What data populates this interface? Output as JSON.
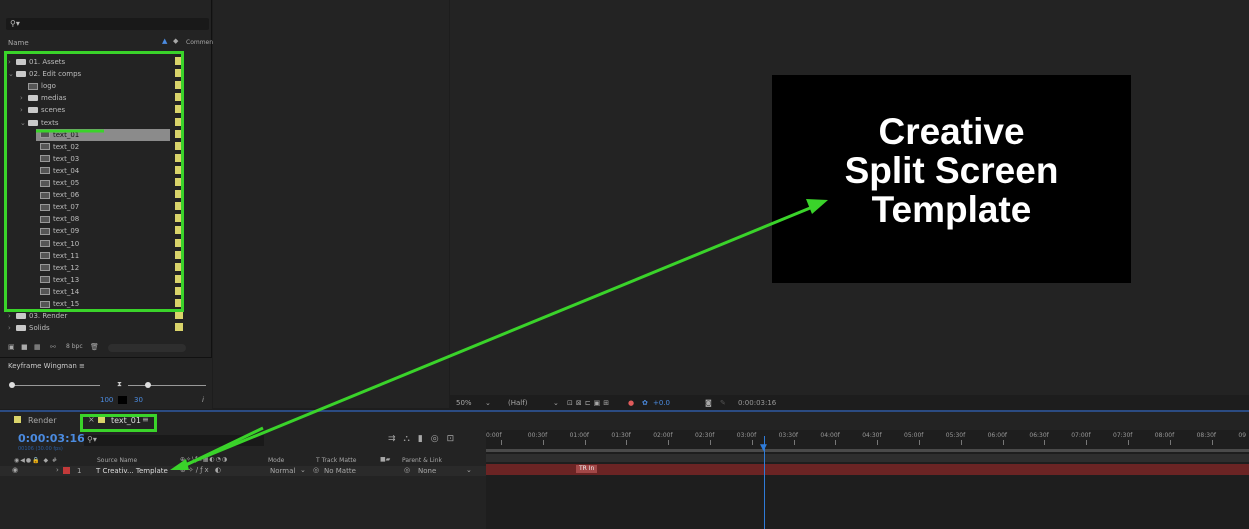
{
  "project": {
    "search_placeholder": "⚲▾",
    "col_name": "Name",
    "col_comment": "Comment",
    "rows": [
      {
        "label": "01. Assets",
        "type": "folder",
        "indent": 0,
        "chev": "›"
      },
      {
        "label": "02. Edit comps",
        "type": "folder",
        "indent": 0,
        "chev": "⌄"
      },
      {
        "label": "logo",
        "type": "comp",
        "indent": 1,
        "chev": ""
      },
      {
        "label": "medias",
        "type": "folder",
        "indent": 1,
        "chev": "›"
      },
      {
        "label": "scenes",
        "type": "folder",
        "indent": 1,
        "chev": "›"
      },
      {
        "label": "texts",
        "type": "folder",
        "indent": 1,
        "chev": "⌄"
      },
      {
        "label": "text_01",
        "type": "comp",
        "indent": 2,
        "chev": "",
        "selected": true
      },
      {
        "label": "text_02",
        "type": "comp",
        "indent": 2,
        "chev": ""
      },
      {
        "label": "text_03",
        "type": "comp",
        "indent": 2,
        "chev": ""
      },
      {
        "label": "text_04",
        "type": "comp",
        "indent": 2,
        "chev": ""
      },
      {
        "label": "text_05",
        "type": "comp",
        "indent": 2,
        "chev": ""
      },
      {
        "label": "text_06",
        "type": "comp",
        "indent": 2,
        "chev": ""
      },
      {
        "label": "text_07",
        "type": "comp",
        "indent": 2,
        "chev": ""
      },
      {
        "label": "text_08",
        "type": "comp",
        "indent": 2,
        "chev": ""
      },
      {
        "label": "text_09",
        "type": "comp",
        "indent": 2,
        "chev": ""
      },
      {
        "label": "text_10",
        "type": "comp",
        "indent": 2,
        "chev": ""
      },
      {
        "label": "text_11",
        "type": "comp",
        "indent": 2,
        "chev": ""
      },
      {
        "label": "text_12",
        "type": "comp",
        "indent": 2,
        "chev": ""
      },
      {
        "label": "text_13",
        "type": "comp",
        "indent": 2,
        "chev": ""
      },
      {
        "label": "text_14",
        "type": "comp",
        "indent": 2,
        "chev": ""
      },
      {
        "label": "text_15",
        "type": "comp",
        "indent": 2,
        "chev": ""
      },
      {
        "label": "03. Render",
        "type": "folder",
        "indent": 0,
        "chev": "›"
      },
      {
        "label": "Solids",
        "type": "folder",
        "indent": 0,
        "chev": "›"
      }
    ],
    "bpc": "8 bpc"
  },
  "wingman": {
    "title": "Keyframe Wingman  ≡",
    "val1": "100",
    "val2": "30",
    "italic": "i"
  },
  "poster": {
    "line1": "Creative",
    "line2": "Split Screen",
    "line3": "Template"
  },
  "viewbar": {
    "zoom": "50%",
    "res": "(Half)",
    "exposure": "+0.0",
    "timecode": "0:00:03:16"
  },
  "timeline": {
    "tab_render": "Render",
    "tab_comp": "text_01",
    "current_time": "0:00:03:16",
    "frames": "00106 (30.00 fps)",
    "search_placeholder": "⚲▾",
    "col_source": "Source Name",
    "col_mode": "Mode",
    "col_t": "T  Track Matte",
    "col_parent": "Parent & Link",
    "layer_num": "1",
    "layer_name": "T  Creativ... Template",
    "layer_mode": "Normal",
    "layer_matte": "No Matte",
    "layer_parent": "None",
    "marker": "TR In",
    "ruler": [
      "0:00f",
      "00:30f",
      "01:00f",
      "01:30f",
      "02:00f",
      "02:30f",
      "03:00f",
      "03:30f",
      "04:00f",
      "04:30f",
      "05:00f",
      "05:30f",
      "06:00f",
      "06:30f",
      "07:00f",
      "07:30f",
      "08:00f",
      "08:30f",
      "09"
    ]
  }
}
